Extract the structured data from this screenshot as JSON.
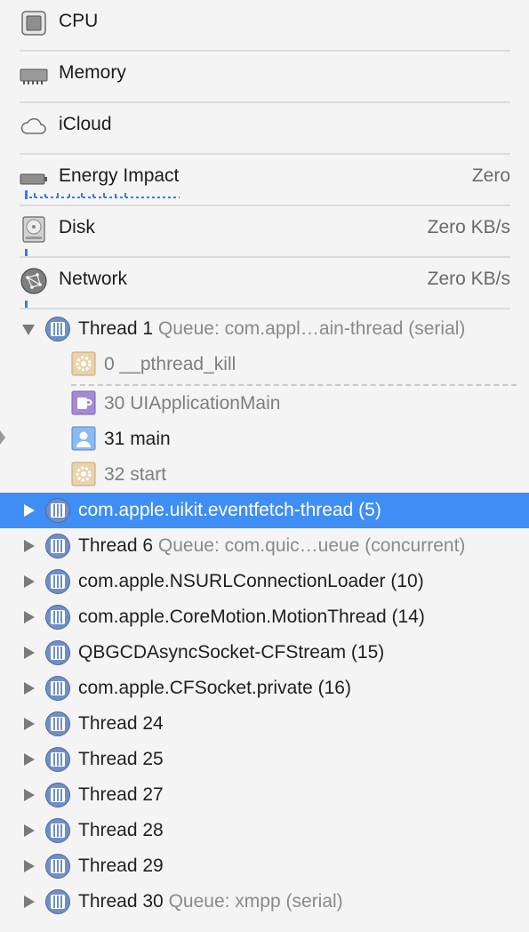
{
  "gauges": {
    "cpu": {
      "title": "CPU",
      "value": ""
    },
    "memory": {
      "title": "Memory",
      "value": ""
    },
    "icloud": {
      "title": "iCloud",
      "value": ""
    },
    "energy": {
      "title": "Energy Impact",
      "value": "Zero"
    },
    "disk": {
      "title": "Disk",
      "value": "Zero KB/s"
    },
    "network": {
      "title": "Network",
      "value": "Zero KB/s"
    }
  },
  "thread1": {
    "name": "Thread 1",
    "queue": "Queue: com.appl…ain-thread (serial)",
    "expanded": true,
    "frames": [
      {
        "label": "0 __pthread_kill",
        "icon": "gear-icon",
        "style": "gray"
      },
      {
        "label": "30 UIApplicationMain",
        "icon": "cup-icon",
        "style": "gray"
      },
      {
        "label": "31 main",
        "icon": "user-icon",
        "style": "dark"
      },
      {
        "label": "32 start",
        "icon": "gear-icon",
        "style": "gray"
      }
    ]
  },
  "threads": [
    {
      "name": "com.apple.uikit.eventfetch-thread (5)",
      "queue": "",
      "selected": true
    },
    {
      "name": "Thread 6",
      "queue": "Queue: com.quic…ueue (concurrent)",
      "selected": false
    },
    {
      "name": "com.apple.NSURLConnectionLoader (10)",
      "queue": "",
      "selected": false
    },
    {
      "name": "com.apple.CoreMotion.MotionThread (14)",
      "queue": "",
      "selected": false
    },
    {
      "name": "QBGCDAsyncSocket-CFStream (15)",
      "queue": "",
      "selected": false
    },
    {
      "name": "com.apple.CFSocket.private (16)",
      "queue": "",
      "selected": false
    },
    {
      "name": "Thread 24",
      "queue": "",
      "selected": false
    },
    {
      "name": "Thread 25",
      "queue": "",
      "selected": false
    },
    {
      "name": "Thread 27",
      "queue": "",
      "selected": false
    },
    {
      "name": "Thread 28",
      "queue": "",
      "selected": false
    },
    {
      "name": "Thread 29",
      "queue": "",
      "selected": false
    },
    {
      "name": "Thread 30",
      "queue": "Queue: xmpp (serial)",
      "selected": false
    }
  ],
  "colors": {
    "selection": "#3f8ef5",
    "thread_icon": "#6f8fc6",
    "sparkline": "#2d7ff0"
  }
}
